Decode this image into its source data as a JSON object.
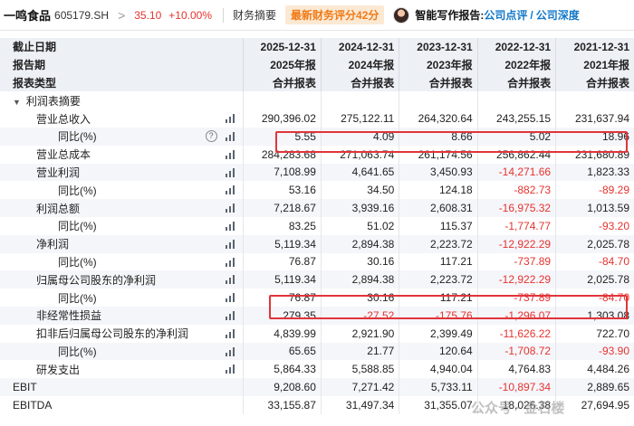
{
  "header": {
    "stock_name": "一鸣食品",
    "stock_code": "605179.SH",
    "chevron": ">",
    "price": "35.10",
    "change_pct": "+10.00%",
    "tab_label": "财务摘要",
    "score_badge": "最新财务评分42分",
    "ai_label": "智能写作报告:",
    "ai_link_1": "公司点评",
    "ai_slash": "/",
    "ai_link_2": "公司深度"
  },
  "table": {
    "header_rows": [
      {
        "label": "截止日期",
        "cells": [
          "2025-12-31",
          "2024-12-31",
          "2023-12-31",
          "2022-12-31",
          "2021-12-31"
        ]
      },
      {
        "label": "报告期",
        "cells": [
          "2025年报",
          "2024年报",
          "2023年报",
          "2022年报",
          "2021年报"
        ]
      },
      {
        "label": "报表类型",
        "cells": [
          "合并报表",
          "合并报表",
          "合并报表",
          "合并报表",
          "合并报表"
        ]
      }
    ],
    "section_label": "利润表摘要",
    "rows": [
      {
        "label": "营业总收入",
        "cells": [
          "290,396.02",
          "275,122.11",
          "264,320.64",
          "243,255.15",
          "231,637.94"
        ]
      },
      {
        "label": "同比(%)",
        "cells": [
          "5.55",
          "4.09",
          "8.66",
          "5.02",
          "18.96"
        ]
      },
      {
        "label": "营业总成本",
        "cells": [
          "284,283.68",
          "271,063.74",
          "261,174.56",
          "256,862.44",
          "231,680.89"
        ]
      },
      {
        "label": "营业利润",
        "cells": [
          "7,108.99",
          "4,641.65",
          "3,450.93",
          "-14,271.66",
          "1,823.33"
        ]
      },
      {
        "label": "同比(%)",
        "cells": [
          "53.16",
          "34.50",
          "124.18",
          "-882.73",
          "-89.29"
        ]
      },
      {
        "label": "利润总额",
        "cells": [
          "7,218.67",
          "3,939.16",
          "2,608.31",
          "-16,975.32",
          "1,013.59"
        ]
      },
      {
        "label": "同比(%)",
        "cells": [
          "83.25",
          "51.02",
          "115.37",
          "-1,774.77",
          "-93.20"
        ]
      },
      {
        "label": "净利润",
        "cells": [
          "5,119.34",
          "2,894.38",
          "2,223.72",
          "-12,922.29",
          "2,025.78"
        ]
      },
      {
        "label": "同比(%)",
        "cells": [
          "76.87",
          "30.16",
          "117.21",
          "-737.89",
          "-84.70"
        ]
      },
      {
        "label": "归属母公司股东的净利润",
        "cells": [
          "5,119.34",
          "2,894.38",
          "2,223.72",
          "-12,922.29",
          "2,025.78"
        ]
      },
      {
        "label": "同比(%)",
        "cells": [
          "76.87",
          "30.16",
          "117.21",
          "-737.89",
          "-84.70"
        ]
      },
      {
        "label": "非经常性损益",
        "cells": [
          "279.35",
          "-27.52",
          "-175.76",
          "-1,296.07",
          "1,303.08"
        ]
      },
      {
        "label": "扣非后归属母公司股东的净利润",
        "cells": [
          "4,839.99",
          "2,921.90",
          "2,399.49",
          "-11,626.22",
          "722.70"
        ]
      },
      {
        "label": "同比(%)",
        "cells": [
          "65.65",
          "21.77",
          "120.64",
          "-1,708.72",
          "-93.90"
        ]
      },
      {
        "label": "研发支出",
        "cells": [
          "5,864.33",
          "5,588.85",
          "4,940.04",
          "4,764.83",
          "4,484.26"
        ]
      },
      {
        "label": "EBIT",
        "cells": [
          "9,208.60",
          "7,271.42",
          "5,733.11",
          "-10,897.34",
          "2,889.65"
        ]
      },
      {
        "label": "EBITDA",
        "cells": [
          "33,155.87",
          "31,497.34",
          "31,355.07",
          "18,026.38",
          "27,694.95"
        ]
      }
    ]
  },
  "help_glyph": "?",
  "watermark": "公众号 · 金石楼",
  "colors": {
    "negative": "#e5332f",
    "highlight_box": "#e0353a",
    "header_bg": "#edf0f5",
    "band_bg": "#f5f6fa",
    "link": "#1478c8",
    "badge_text": "#f07a16"
  },
  "icons": {
    "row_chart": "bar-chart-icon",
    "help": "help-icon",
    "collapse": "caret-down-icon"
  }
}
